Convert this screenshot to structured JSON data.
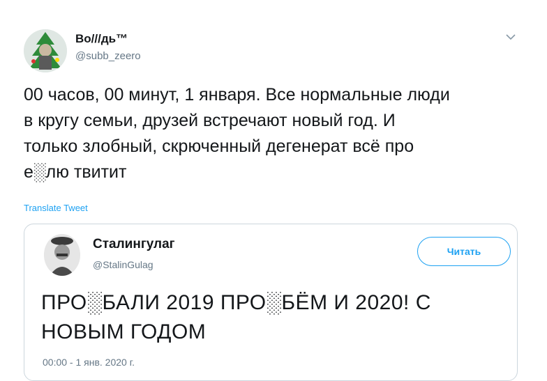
{
  "tweet": {
    "author_name": "Во///дь™",
    "author_handle": "@subb_zeero",
    "text": "00 часов, 00 минут, 1 января. Все нормальные люди\nв кругу семьи, друзей встречают новый год. И\nтолько злобный, скрюченный дегенерат всё про\ne░лю твитит",
    "translate_label": "Translate Tweet"
  },
  "quoted": {
    "author_name": "Сталингулаг",
    "author_handle": "@StalinGulag",
    "follow_label": "Читать",
    "text": "ПРО░БАЛИ 2019 ПРО░БЁМ И 2020! С\nНОВЫМ ГОДОМ",
    "timestamp": "00:00 - 1 янв. 2020 г."
  },
  "colors": {
    "accent": "#1da1f2",
    "secondary_text": "#657786",
    "border": "#ccd6dd"
  },
  "icons": {
    "caret": "chevron-down-icon"
  }
}
